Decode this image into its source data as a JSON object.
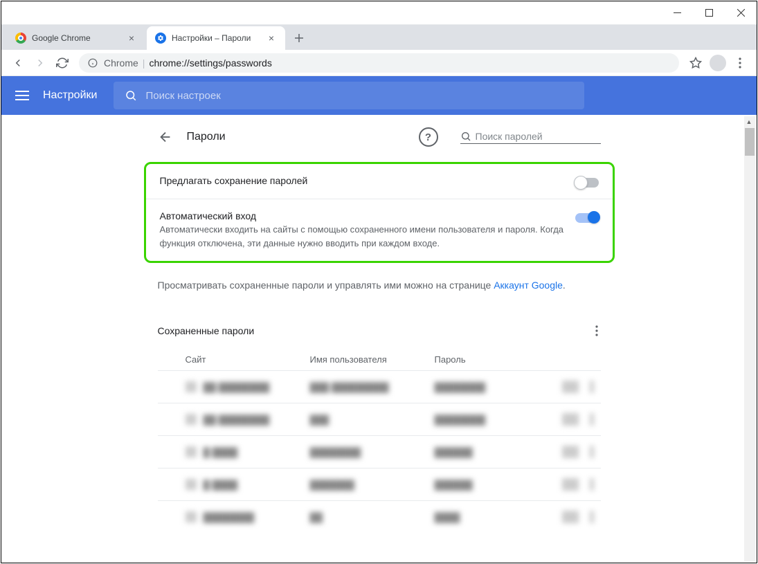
{
  "tabs": [
    {
      "title": "Google Chrome",
      "icon_bg": "linear-gradient(135deg,#ea4335 0%,#fbbc05 33%,#34a853 66%,#4285f4 100%)"
    },
    {
      "title": "Настройки – Пароли",
      "icon_bg": "#1a73e8"
    }
  ],
  "address": {
    "prefix": "Chrome",
    "path": "chrome://settings/passwords"
  },
  "header": {
    "title": "Настройки",
    "search_placeholder": "Поиск настроек"
  },
  "page": {
    "back_title": "Пароли",
    "help": "?",
    "pw_search_placeholder": "Поиск паролей",
    "offer_save": {
      "title": "Предлагать сохранение паролей"
    },
    "auto_login": {
      "title": "Автоматический вход",
      "desc": "Автоматически входить на сайты с помощью сохраненного имени пользователя и пароля. Когда функция отключена, эти данные нужно вводить при каждом входе."
    },
    "manage_text": "Просматривать сохраненные пароли и управлять ими можно на странице ",
    "manage_link": "Аккаунт Google",
    "saved_title": "Сохраненные пароли",
    "cols": {
      "site": "Сайт",
      "user": "Имя пользователя",
      "pass": "Пароль"
    },
    "rows": [
      {
        "site": "██ ████████",
        "user": "███ █████████",
        "pass": "████████"
      },
      {
        "site": "██ ████████",
        "user": "███",
        "pass": "████████"
      },
      {
        "site": "█  ████",
        "user": "████████",
        "pass": "██████"
      },
      {
        "site": "█  ████",
        "user": "███████",
        "pass": "██████"
      },
      {
        "site": "████████",
        "user": "██",
        "pass": "████"
      }
    ]
  }
}
